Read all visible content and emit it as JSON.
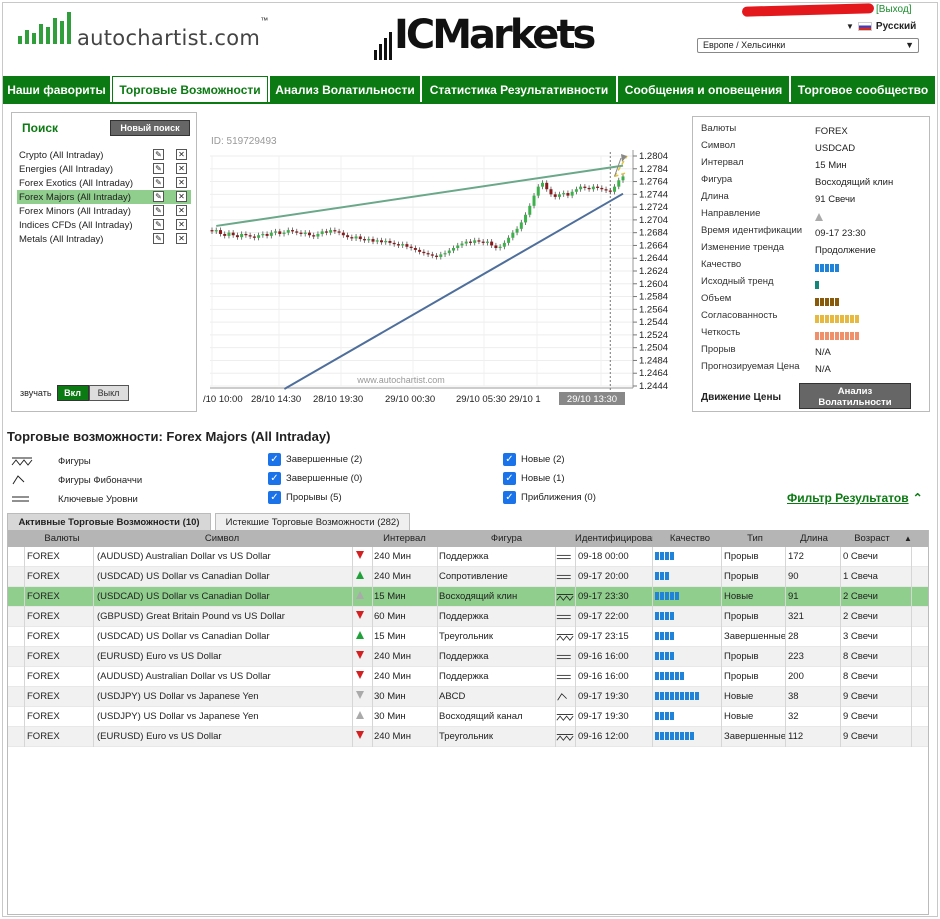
{
  "header": {
    "autochartist_logo": "autochartist.com",
    "logo_tm": "™",
    "icmarkets_logo": "ICMarkets",
    "logout": "[Выход]",
    "language": "Русский",
    "timezone": "Европе / Хельсинки"
  },
  "tabs": [
    {
      "label": "Наши фавориты"
    },
    {
      "label": "Торговые Возможности",
      "active": true
    },
    {
      "label": "Анализ Волатильности"
    },
    {
      "label": "Статистика Результативности"
    },
    {
      "label": "Сообщения и оповещения"
    },
    {
      "label": "Торговое сообщество"
    }
  ],
  "search": {
    "title": "Поиск",
    "new_button": "Новый поиск",
    "items": [
      {
        "label": "Crypto (All Intraday)"
      },
      {
        "label": "Energies (All Intraday)"
      },
      {
        "label": "Forex Exotics (All Intraday)"
      },
      {
        "label": "Forex Majors (All Intraday)",
        "selected": true
      },
      {
        "label": "Forex Minors (All Intraday)"
      },
      {
        "label": "Indices CFDs (All Intraday)"
      },
      {
        "label": "Metals (All Intraday)"
      }
    ],
    "edit_icon": "pencil-icon",
    "delete_icon": "x-icon",
    "sound_label": "звучать",
    "sound_on": "Вкл",
    "sound_off": "Выкл"
  },
  "chart": {
    "id_label": "ID: 519729493",
    "watermark": "www.autochartist.com",
    "y_ticks": [
      "1.2804",
      "1.2784",
      "1.2764",
      "1.2744",
      "1.2724",
      "1.2704",
      "1.2684",
      "1.2664",
      "1.2644",
      "1.2624",
      "1.2604",
      "1.2584",
      "1.2564",
      "1.2544",
      "1.2524",
      "1.2504",
      "1.2484",
      "1.2464",
      "1.2444"
    ],
    "x_ticks": [
      "/10 10:00",
      "28/10 14:30",
      "28/10 19:30",
      "29/10 00:30",
      "29/10 05:30",
      "29/10 1",
      "29/10 13:30"
    ]
  },
  "chart_data": {
    "type": "candlestick",
    "title": "",
    "ylim": [
      1.2444,
      1.2804
    ],
    "x_labels": [
      "/10 10:00",
      "28/10 14:30",
      "28/10 19:30",
      "29/10 00:30",
      "29/10 05:30",
      "29/10 1",
      "29/10 13:30"
    ],
    "y_ticks": [
      1.2804,
      1.2784,
      1.2764,
      1.2744,
      1.2724,
      1.2704,
      1.2684,
      1.2664,
      1.2644,
      1.2624,
      1.2604,
      1.2584,
      1.2564,
      1.2544,
      1.2524,
      1.2504,
      1.2484,
      1.2464,
      1.2444
    ],
    "close_path": [
      1.2686,
      1.2688,
      1.2682,
      1.2679,
      1.2684,
      1.268,
      1.2677,
      1.2682,
      1.268,
      1.2678,
      1.2676,
      1.268,
      1.2682,
      1.2679,
      1.2684,
      1.2686,
      1.2682,
      1.2684,
      1.2688,
      1.2686,
      1.2684,
      1.2682,
      1.2684,
      1.268,
      1.2678,
      1.2682,
      1.2686,
      1.2684,
      1.2688,
      1.2686,
      1.2684,
      1.268,
      1.2677,
      1.2675,
      1.2678,
      1.2674,
      1.2672,
      1.2674,
      1.267,
      1.2672,
      1.2669,
      1.2671,
      1.2668,
      1.2666,
      1.2664,
      1.2666,
      1.2662,
      1.266,
      1.2657,
      1.2654,
      1.2652,
      1.265,
      1.2648,
      1.2646,
      1.265,
      1.2652,
      1.2656,
      1.266,
      1.2664,
      1.2667,
      1.267,
      1.2668,
      1.2672,
      1.267,
      1.2668,
      1.267,
      1.2664,
      1.266,
      1.2662,
      1.2668,
      1.2676,
      1.2684,
      1.269,
      1.27,
      1.2712,
      1.2726,
      1.2742,
      1.2756,
      1.2762,
      1.2752,
      1.2744,
      1.274,
      1.2744,
      1.2746,
      1.2742,
      1.2748,
      1.2752,
      1.2756,
      1.2754,
      1.2752,
      1.2756,
      1.2754,
      1.2752,
      1.275,
      1.2748,
      1.2756,
      1.2766,
      1.2772
    ],
    "resistance_line": [
      [
        1,
        1.2682
      ],
      [
        97,
        1.2789
      ]
    ],
    "support_line": [
      [
        10,
        1.2455
      ],
      [
        97,
        1.2745
      ]
    ],
    "projection": {
      "from": 1.2772,
      "to_upper": 1.2804,
      "to_lower": 1.2778
    },
    "current_time_label": "29/10 13:30"
  },
  "details": {
    "rows": [
      {
        "k": "Валюты",
        "v": "FOREX"
      },
      {
        "k": "Символ",
        "v": "USDCAD"
      },
      {
        "k": "Интервал",
        "v": "15 Мин"
      },
      {
        "k": "Фигура",
        "v": "Восходящий клин"
      },
      {
        "k": "Длина",
        "v": "91 Свечи"
      },
      {
        "k": "Направление",
        "v": "",
        "icon": "up-triangle-icon"
      },
      {
        "k": "Время идентификации",
        "v": "09-17 23:30"
      },
      {
        "k": "Изменение тренда",
        "v": "Продолжение"
      },
      {
        "k": "Качество",
        "v": "",
        "bars": 5,
        "bar_color": "#1e83d9"
      },
      {
        "k": "Исходный тренд",
        "v": "",
        "bars": 1,
        "bar_color": "#13867a"
      },
      {
        "k": "Объем",
        "v": "",
        "bars": 5,
        "bar_color": "#8a5a0c"
      },
      {
        "k": "Согласованность",
        "v": "",
        "bars": 9,
        "bar_color": "#e8b941"
      },
      {
        "k": "Четкость",
        "v": "",
        "bars": 9,
        "bar_color": "#f0906a"
      },
      {
        "k": "Прорыв",
        "v": "N/A"
      },
      {
        "k": "Прогнозируемая Цена",
        "v": "N/A"
      }
    ],
    "footer_label": "Движение Цены",
    "volatility_button": "Анализ Волатильности"
  },
  "opportunities": {
    "title": "Торговые возможности: Forex Majors (All Intraday)",
    "legend": [
      {
        "label": "Фигуры",
        "icon": "pattern-icon"
      },
      {
        "label": "Фигуры Фибоначчи",
        "icon": "fibonacci-icon"
      },
      {
        "label": "Ключевые Уровни",
        "icon": "key-levels-icon"
      }
    ],
    "filters_col2": [
      "Завершенные (2)",
      "Завершенные (0)",
      "Прорывы (5)"
    ],
    "filters_col3": [
      "Новые (2)",
      "Новые (1)",
      "Приближения (0)"
    ],
    "filter_link": "Фильтр Результатов",
    "active_tab": "Активные Торговые Возможности (10)",
    "expired_tab": "Истекшие Торговые Возможности (282)",
    "columns": [
      "Валюты",
      "Символ",
      "Интервал",
      "Фигура",
      "Идентифицирован",
      "Качество",
      "Тип",
      "Длина",
      "Возраст"
    ],
    "sort_indicator": "▲",
    "rows": [
      {
        "group": "FOREX",
        "symbol": "(AUDUSD) Australian Dollar vs US Dollar",
        "dir": "down",
        "interval": "240 Мин",
        "pattern": "Поддержка",
        "ptype": "level",
        "time": "09-18 00:00",
        "q": 4,
        "type": "Прорыв",
        "len": "172",
        "age": "0 Свечи"
      },
      {
        "group": "FOREX",
        "symbol": "(USDCAD) US Dollar vs Canadian Dollar",
        "dir": "up",
        "interval": "240 Мин",
        "pattern": "Сопротивление",
        "ptype": "level",
        "time": "09-17 20:00",
        "q": 3,
        "type": "Прорыв",
        "len": "90",
        "age": "1 Свеча"
      },
      {
        "group": "FOREX",
        "symbol": "(USDCAD) US Dollar vs Canadian Dollar",
        "dir": "up-grey",
        "interval": "15 Мин",
        "pattern": "Восходящий клин",
        "ptype": "pattern",
        "time": "09-17 23:30",
        "q": 5,
        "type": "Новые",
        "len": "91",
        "age": "2 Свечи",
        "selected": true
      },
      {
        "group": "FOREX",
        "symbol": "(GBPUSD) Great Britain Pound vs US Dollar",
        "dir": "down",
        "interval": "60 Мин",
        "pattern": "Поддержка",
        "ptype": "level",
        "time": "09-17 22:00",
        "q": 4,
        "type": "Прорыв",
        "len": "321",
        "age": "2 Свечи"
      },
      {
        "group": "FOREX",
        "symbol": "(USDCAD) US Dollar vs Canadian Dollar",
        "dir": "up",
        "interval": "15 Мин",
        "pattern": "Треугольник",
        "ptype": "pattern",
        "time": "09-17 23:15",
        "q": 4,
        "type": "Завершенные",
        "len": "28",
        "age": "3 Свечи"
      },
      {
        "group": "FOREX",
        "symbol": "(EURUSD) Euro vs US Dollar",
        "dir": "down",
        "interval": "240 Мин",
        "pattern": "Поддержка",
        "ptype": "level",
        "time": "09-16 16:00",
        "q": 4,
        "type": "Прорыв",
        "len": "223",
        "age": "8 Свечи"
      },
      {
        "group": "FOREX",
        "symbol": "(AUDUSD) Australian Dollar vs US Dollar",
        "dir": "down",
        "interval": "240 Мин",
        "pattern": "Поддержка",
        "ptype": "level",
        "time": "09-16 16:00",
        "q": 6,
        "type": "Прорыв",
        "len": "200",
        "age": "8 Свечи"
      },
      {
        "group": "FOREX",
        "symbol": "(USDJPY) US Dollar vs Japanese Yen",
        "dir": "down-grey",
        "interval": "30 Мин",
        "pattern": "ABCD",
        "ptype": "fib",
        "time": "09-17 19:30",
        "q": 9,
        "type": "Новые",
        "len": "38",
        "age": "9 Свечи"
      },
      {
        "group": "FOREX",
        "symbol": "(USDJPY) US Dollar vs Japanese Yen",
        "dir": "up-grey",
        "interval": "30 Мин",
        "pattern": "Восходящий канал",
        "ptype": "pattern",
        "time": "09-17 19:30",
        "q": 4,
        "type": "Новые",
        "len": "32",
        "age": "9 Свечи"
      },
      {
        "group": "FOREX",
        "symbol": "(EURUSD) Euro vs US Dollar",
        "dir": "down",
        "interval": "240 Мин",
        "pattern": "Треугольник",
        "ptype": "pattern",
        "time": "09-16 12:00",
        "q": 8,
        "type": "Завершенные",
        "len": "112",
        "age": "9 Свечи"
      }
    ]
  }
}
